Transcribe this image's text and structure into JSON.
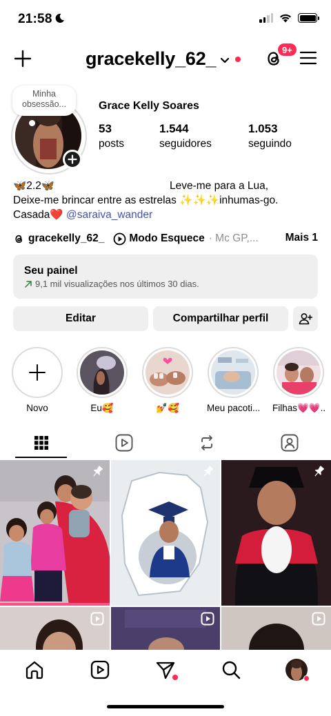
{
  "status_bar": {
    "time": "21:58"
  },
  "header": {
    "username": "gracekelly_62_",
    "notification_badge": "9+"
  },
  "profile": {
    "note": "Minha obsessão...",
    "full_name": "Grace Kelly Soares",
    "stats": [
      {
        "value": "53",
        "label": "posts"
      },
      {
        "value": "1.544",
        "label": "seguidores"
      },
      {
        "value": "1.053",
        "label": "seguindo"
      }
    ],
    "bio": {
      "line1_start": "🦋2.2🦋",
      "line1_end": "Leve-me para a Lua,",
      "line2": "Deixe-me brincar entre as estrelas   ✨✨✨inhumas-go.",
      "line3_prefix": "Casada❤️",
      "mention": "@saraiva_wander"
    },
    "threads_handle": "gracekelly_62_",
    "music_title": "Modo Esquece",
    "music_artist": "· Mc GP,...",
    "more_label": "Mais 1"
  },
  "dashboard": {
    "title": "Seu painel",
    "subtitle": "9,1 mil visualizações nos últimos 30 dias."
  },
  "buttons": {
    "edit": "Editar",
    "share": "Compartilhar perfil"
  },
  "highlights": [
    {
      "label": "Novo"
    },
    {
      "label": "Eu🥰"
    },
    {
      "label": "💅🥰"
    },
    {
      "label": "Meu pacoti..."
    },
    {
      "label": "Filhas💗💗..."
    }
  ],
  "colors": {
    "accent_red": "#ff2b55",
    "mention_blue": "#3f52b5",
    "panel_gray": "#efefef"
  },
  "icons": [
    "plus-icon",
    "chevron-down-icon",
    "threads-icon",
    "menu-icon",
    "grid-icon",
    "reels-tab-icon",
    "repost-icon",
    "tagged-icon",
    "home-icon",
    "reels-icon",
    "direct-icon",
    "search-icon"
  ]
}
